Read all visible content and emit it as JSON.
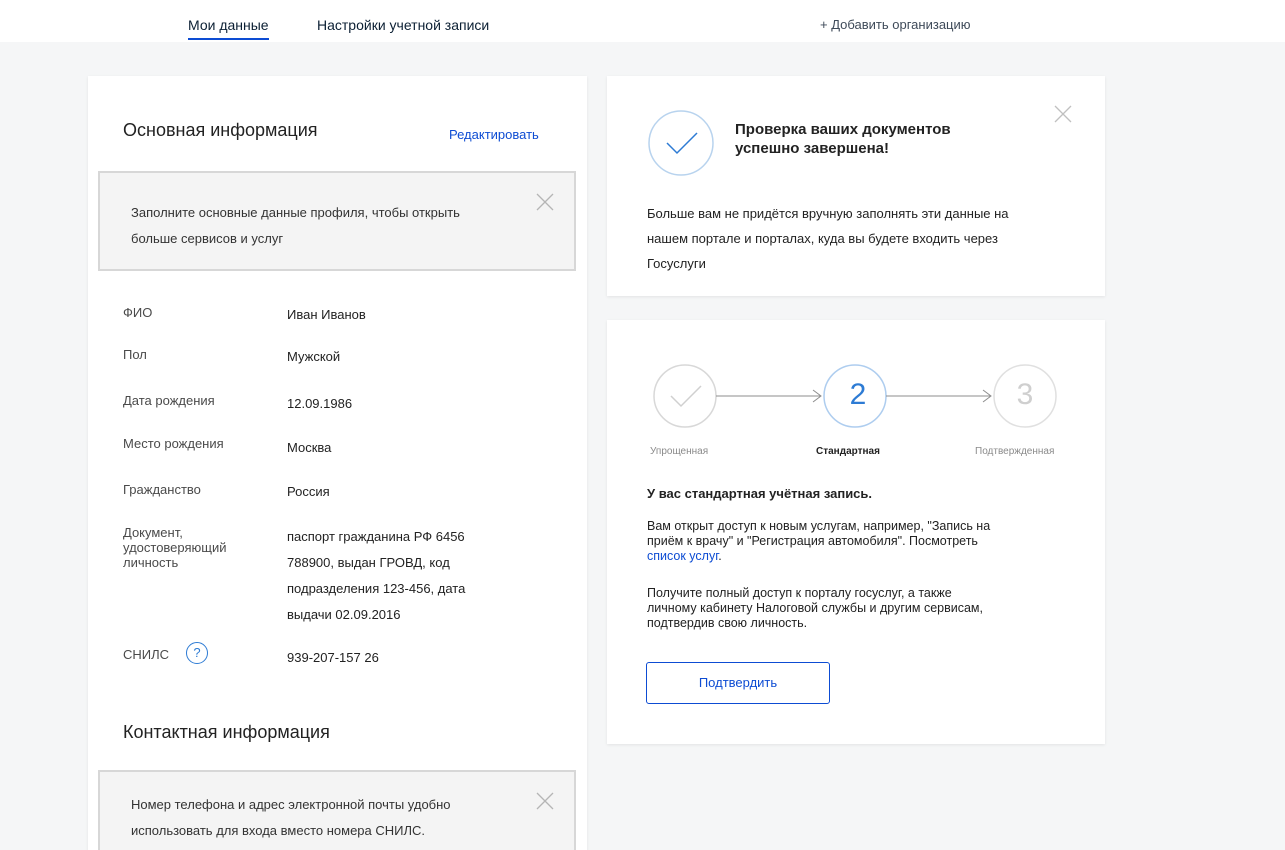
{
  "tabs": {
    "my_data": "Мои данные",
    "account_settings": "Настройки учетной записи",
    "add_org": "+ Добавить организацию"
  },
  "basic_info": {
    "title": "Основная информация",
    "edit_label": "Редактировать",
    "notice_line1": "Заполните основные данные профиля, чтобы открыть",
    "notice_line2": "больше сервисов и услуг",
    "fields": [
      {
        "label": "ФИО",
        "value": "Иван Иванов"
      },
      {
        "label": "Пол",
        "value": "Мужской"
      },
      {
        "label": "Дата рождения",
        "value": "12.09.1986"
      },
      {
        "label": "Место рождения",
        "value": "Москва"
      },
      {
        "label": "Гражданство",
        "value": "Россия"
      },
      {
        "label_lines": [
          "Документ,",
          "удостоверяющий",
          "личность"
        ],
        "value_lines": [
          "паспорт гражданина РФ 6456",
          "788900, выдан ГРОВД, код",
          "подразделения 123-456, дата",
          "выдачи 02.09.2016"
        ]
      },
      {
        "label": "СНИЛС",
        "value": "939-207-157 26",
        "help": "?"
      }
    ]
  },
  "contact_info": {
    "title": "Контактная информация",
    "notice_line1": "Номер телефона и адрес электронной почты удобно",
    "notice_line2": "использовать для входа вместо номера СНИЛС."
  },
  "verification": {
    "title_line1": "Проверка ваших документов",
    "title_line2": "успешно завершена!",
    "body_line1": "Больше вам не придётся вручную заполнять эти данные на",
    "body_line2": "нашем портале и порталах, куда вы будете входить через",
    "body_line3": "Госуслуги"
  },
  "account_level": {
    "steps": [
      {
        "label": "Упрощенная",
        "state": "done",
        "icon": "check-icon"
      },
      {
        "label": "Стандартная",
        "state": "current",
        "number": "2"
      },
      {
        "label": "Подтвержденная",
        "state": "pending",
        "number": "3"
      }
    ],
    "status_head": "У вас стандартная учётная запись.",
    "para1_line1": "Вам открыт доступ к новым услугам, например, \"Запись на",
    "para1_line2": "приём к врачу\" и \"Регистрация автомобиля\". Посмотреть",
    "para1_link": "список услуг",
    "para1_end": ".",
    "para2_line1": "Получите полный доступ к порталу госуслуг, а также",
    "para2_line2": "личному кабинету Налоговой службы и другим сервисам,",
    "para2_line3": "подтвердив свою личность.",
    "confirm_label": "Подтвердить"
  },
  "colors": {
    "accent": "#0d4cd3",
    "icon_blue": "#2d7bd4",
    "background": "#f5f6f7"
  }
}
